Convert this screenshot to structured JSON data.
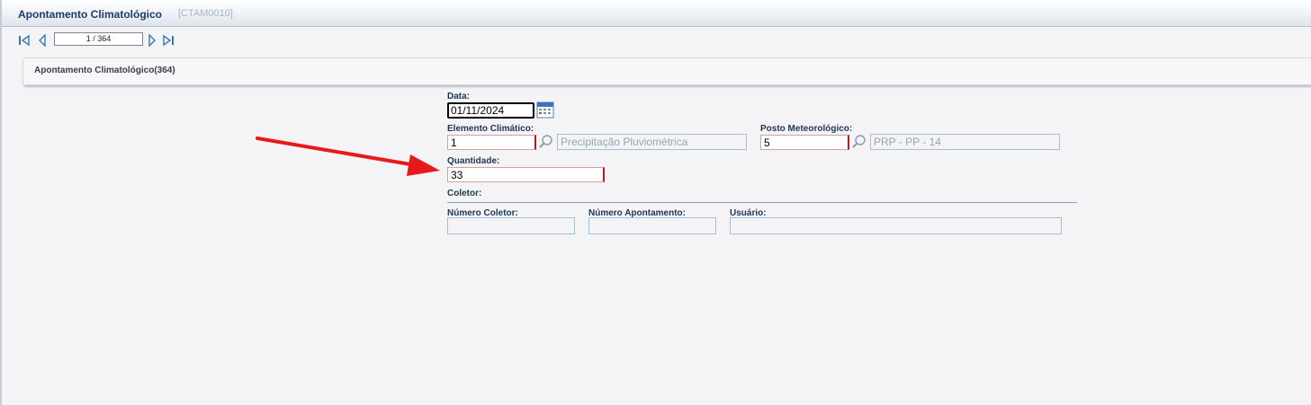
{
  "window": {
    "title": "Apontamento Climatológico",
    "code": "[CTAM0010]"
  },
  "navigation": {
    "record_indicator": "1 / 364",
    "first_icon": "first-record-icon",
    "prev_icon": "previous-record-icon",
    "next_icon": "next-record-icon",
    "last_icon": "last-record-icon"
  },
  "panel": {
    "title": "Apontamento Climatológico(364)"
  },
  "form": {
    "data": {
      "label": "Data:",
      "value": "01/11/2024",
      "icon": "calendar-icon"
    },
    "elemento": {
      "label": "Elemento Climático:",
      "code": "1",
      "description": "Precipitação Pluviométrica",
      "icon": "search-icon"
    },
    "posto": {
      "label": "Posto Meteorológico:",
      "code": "5",
      "description": "PRP - PP - 14",
      "icon": "search-icon"
    },
    "quantidade": {
      "label": "Quantidade:",
      "value": "33"
    },
    "coletor": {
      "section_label": "Coletor:",
      "numero_coletor": {
        "label": "Número Coletor:",
        "value": ""
      },
      "numero_apontamento": {
        "label": "Número Apontamento:",
        "value": ""
      },
      "usuario": {
        "label": "Usuário:",
        "value": ""
      }
    }
  },
  "colors": {
    "title_text": "#1b3c68",
    "required_border": "#c01818",
    "readonly_border": "#9fbfdd",
    "annotation_arrow": "#e8191b"
  }
}
